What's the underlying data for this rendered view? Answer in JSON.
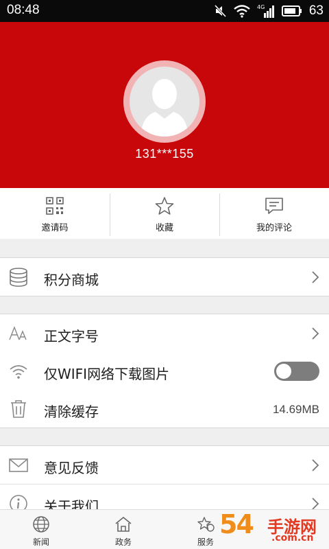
{
  "status_bar": {
    "time": "08:48",
    "battery": "63",
    "network": "4G"
  },
  "profile": {
    "phone": "131***155"
  },
  "quick_actions": [
    {
      "label": "邀请码",
      "icon": "qr-code-icon"
    },
    {
      "label": "收藏",
      "icon": "star-icon"
    },
    {
      "label": "我的评论",
      "icon": "comment-icon"
    }
  ],
  "menu": {
    "points_mall": {
      "label": "积分商城",
      "icon": "database-icon"
    },
    "font_size": {
      "label": "正文字号",
      "icon": "font-size-icon"
    },
    "wifi_only": {
      "label": "仅WIFI网络下载图片",
      "icon": "wifi-icon",
      "enabled": false
    },
    "clear_cache": {
      "label": "清除缓存",
      "icon": "trash-icon",
      "value": "14.69MB"
    },
    "feedback": {
      "label": "意见反馈",
      "icon": "mail-icon"
    },
    "about": {
      "label": "关于我们",
      "icon": "info-icon"
    }
  },
  "tabs": [
    {
      "label": "新闻",
      "icon": "globe-icon"
    },
    {
      "label": "政务",
      "icon": "government-icon"
    },
    {
      "label": "服务",
      "icon": "service-icon"
    }
  ],
  "watermark": {
    "brand_num": "54",
    "brand_cn": "手游网",
    "brand_url": ".com.cn"
  },
  "colors": {
    "header_red": "#c8070a",
    "toggle_off": "#7d7d7d",
    "watermark_orange": "#f08c1a",
    "watermark_red": "#e23a22"
  }
}
